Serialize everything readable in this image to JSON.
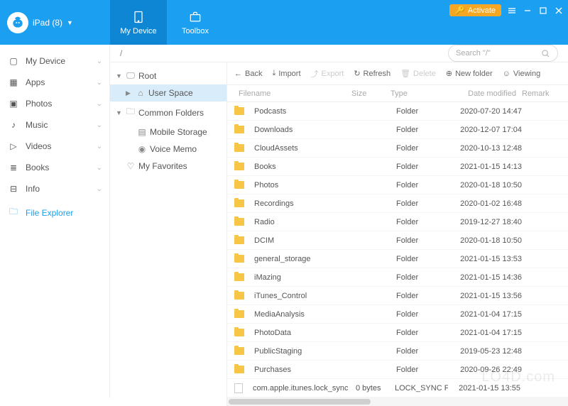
{
  "titlebar": {
    "device_label": "iPad (8)",
    "tabs": {
      "my_device": "My Device",
      "toolbox": "Toolbox"
    },
    "activate": "Activate"
  },
  "sidebar": {
    "items": [
      {
        "label": "My Device",
        "expandable": true
      },
      {
        "label": "Apps",
        "expandable": true
      },
      {
        "label": "Photos",
        "expandable": true
      },
      {
        "label": "Music",
        "expandable": true
      },
      {
        "label": "Videos",
        "expandable": true
      },
      {
        "label": "Books",
        "expandable": true
      },
      {
        "label": "Info",
        "expandable": true
      },
      {
        "label": "File Explorer",
        "expandable": false
      }
    ]
  },
  "path": "/",
  "search_placeholder": "Search \"/\"",
  "tree": {
    "root": "Root",
    "user_space": "User Space",
    "common_folders": "Common Folders",
    "mobile_storage": "Mobile Storage",
    "voice_memo": "Voice Memo",
    "my_favorites": "My Favorites"
  },
  "toolbar": {
    "back": "Back",
    "import": "Import",
    "export": "Export",
    "refresh": "Refresh",
    "delete": "Delete",
    "new_folder": "New folder",
    "viewing": "Viewing"
  },
  "columns": {
    "filename": "Filename",
    "size": "Size",
    "type": "Type",
    "date": "Date modified",
    "remark": "Remark"
  },
  "files": [
    {
      "name": "Podcasts",
      "size": "",
      "type": "Folder",
      "date": "2020-07-20 14:47",
      "kind": "folder"
    },
    {
      "name": "Downloads",
      "size": "",
      "type": "Folder",
      "date": "2020-12-07 17:04",
      "kind": "folder"
    },
    {
      "name": "CloudAssets",
      "size": "",
      "type": "Folder",
      "date": "2020-10-13 12:48",
      "kind": "folder"
    },
    {
      "name": "Books",
      "size": "",
      "type": "Folder",
      "date": "2021-01-15 14:13",
      "kind": "folder"
    },
    {
      "name": "Photos",
      "size": "",
      "type": "Folder",
      "date": "2020-01-18 10:50",
      "kind": "folder"
    },
    {
      "name": "Recordings",
      "size": "",
      "type": "Folder",
      "date": "2020-01-02 16:48",
      "kind": "folder"
    },
    {
      "name": "Radio",
      "size": "",
      "type": "Folder",
      "date": "2019-12-27 18:40",
      "kind": "folder"
    },
    {
      "name": "DCIM",
      "size": "",
      "type": "Folder",
      "date": "2020-01-18 10:50",
      "kind": "folder"
    },
    {
      "name": "general_storage",
      "size": "",
      "type": "Folder",
      "date": "2021-01-15 13:53",
      "kind": "folder"
    },
    {
      "name": "iMazing",
      "size": "",
      "type": "Folder",
      "date": "2021-01-15 14:36",
      "kind": "folder"
    },
    {
      "name": "iTunes_Control",
      "size": "",
      "type": "Folder",
      "date": "2021-01-15 13:56",
      "kind": "folder"
    },
    {
      "name": "MediaAnalysis",
      "size": "",
      "type": "Folder",
      "date": "2021-01-04 17:15",
      "kind": "folder"
    },
    {
      "name": "PhotoData",
      "size": "",
      "type": "Folder",
      "date": "2021-01-04 17:15",
      "kind": "folder"
    },
    {
      "name": "PublicStaging",
      "size": "",
      "type": "Folder",
      "date": "2019-05-23 12:48",
      "kind": "folder"
    },
    {
      "name": "Purchases",
      "size": "",
      "type": "Folder",
      "date": "2020-09-26 22:49",
      "kind": "folder"
    },
    {
      "name": "com.apple.itunes.lock_sync",
      "size": "0 bytes",
      "type": "LOCK_SYNC File",
      "date": "2021-01-15 13:55",
      "kind": "file"
    }
  ],
  "watermark": "LO4D.com"
}
